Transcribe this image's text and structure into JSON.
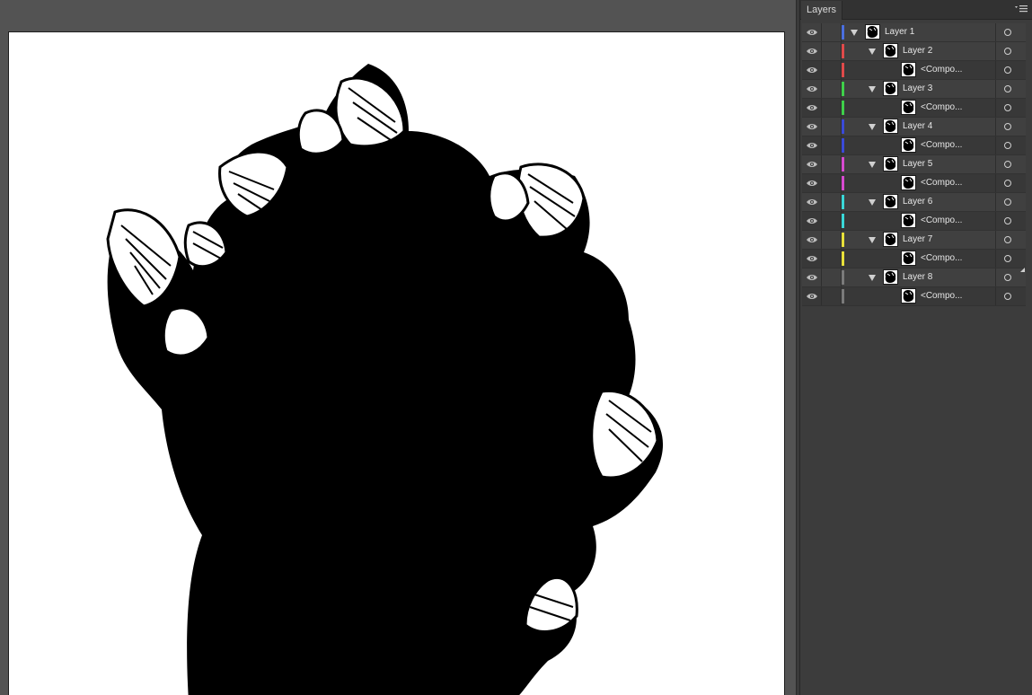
{
  "panel": {
    "tab_label": "Layers",
    "menu_icon": "panel-menu-icon"
  },
  "layers": [
    {
      "name": "Layer 1",
      "level": 0,
      "expanded": true,
      "color": "#4a6fe0",
      "visible": true
    },
    {
      "name": "Layer 2",
      "level": 1,
      "expanded": true,
      "color": "#e04a4a",
      "visible": true
    },
    {
      "name": "<Compo...",
      "level": 2,
      "color": "#e04a4a",
      "visible": true
    },
    {
      "name": "Layer 3",
      "level": 1,
      "expanded": true,
      "color": "#3fd04a",
      "visible": true
    },
    {
      "name": "<Compo...",
      "level": 2,
      "color": "#3fd04a",
      "visible": true
    },
    {
      "name": "Layer 4",
      "level": 1,
      "expanded": true,
      "color": "#3a4ad8",
      "visible": true
    },
    {
      "name": "<Compo...",
      "level": 2,
      "color": "#3a4ad8",
      "visible": true
    },
    {
      "name": "Layer 5",
      "level": 1,
      "expanded": true,
      "color": "#d84ad0",
      "visible": true
    },
    {
      "name": "<Compo...",
      "level": 2,
      "color": "#d84ad0",
      "visible": true
    },
    {
      "name": "Layer 6",
      "level": 1,
      "expanded": true,
      "color": "#3ad8d8",
      "visible": true
    },
    {
      "name": "<Compo...",
      "level": 2,
      "color": "#3ad8d8",
      "visible": true
    },
    {
      "name": "Layer 7",
      "level": 1,
      "expanded": true,
      "color": "#e8e03a",
      "visible": true
    },
    {
      "name": "<Compo...",
      "level": 2,
      "color": "#e8e03a",
      "visible": true
    },
    {
      "name": "Layer 8",
      "level": 1,
      "expanded": true,
      "color": "#7a7a7a",
      "visible": true
    },
    {
      "name": "<Compo...",
      "level": 2,
      "color": "#7a7a7a",
      "visible": true
    }
  ]
}
